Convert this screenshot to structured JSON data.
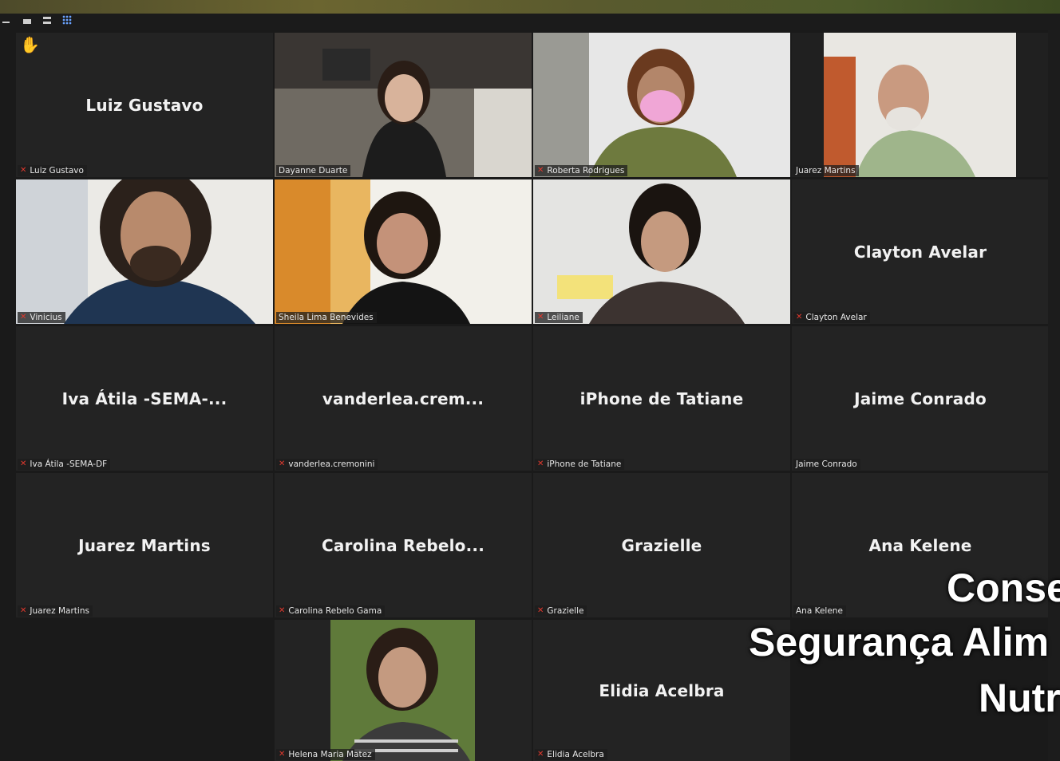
{
  "participants": [
    {
      "display": "Luiz Gustavo",
      "label": "Luiz Gustavo",
      "muted": true
    },
    {
      "display": "",
      "label": "Dayanne Duarte",
      "muted": false
    },
    {
      "display": "",
      "label": "Roberta Rodrigues",
      "muted": true
    },
    {
      "display": "",
      "label": "Juarez Martins",
      "muted": false
    },
    {
      "display": "",
      "label": "Vinicius",
      "muted": true
    },
    {
      "display": "",
      "label": "Sheila Lima Benevides",
      "muted": false
    },
    {
      "display": "",
      "label": "Leiliane",
      "muted": true
    },
    {
      "display": "Clayton Avelar",
      "label": "Clayton Avelar",
      "muted": true
    },
    {
      "display": "Iva Átila -SEMA-...",
      "label": "Iva Átila -SEMA-DF",
      "muted": true
    },
    {
      "display": "vanderlea.crem...",
      "label": "vanderlea.cremonini",
      "muted": true
    },
    {
      "display": "iPhone de Tatiane",
      "label": "iPhone de Tatiane",
      "muted": true
    },
    {
      "display": "Jaime Conrado",
      "label": "Jaime Conrado",
      "muted": false
    },
    {
      "display": "Juarez Martins",
      "label": "Juarez Martins",
      "muted": true
    },
    {
      "display": "Carolina Rebelo...",
      "label": "Carolina Rebelo Gama",
      "muted": true
    },
    {
      "display": "Grazielle",
      "label": "Grazielle",
      "muted": true
    },
    {
      "display": "Ana Kelene",
      "label": "Ana Kelene",
      "muted": false
    },
    {
      "display": "",
      "label": "Helena Maria Matez",
      "muted": true
    },
    {
      "display": "Elidia Acelbra",
      "label": "Elidia Acelbra",
      "muted": true
    }
  ],
  "overlay": {
    "line1": "Conse",
    "line2": "Segurança Alim",
    "line3": "Nutr"
  },
  "colors": {
    "active_speaker_border": "#c8d34a",
    "muted_icon": "#e0392e",
    "raised_hand": "#f2b51c"
  }
}
